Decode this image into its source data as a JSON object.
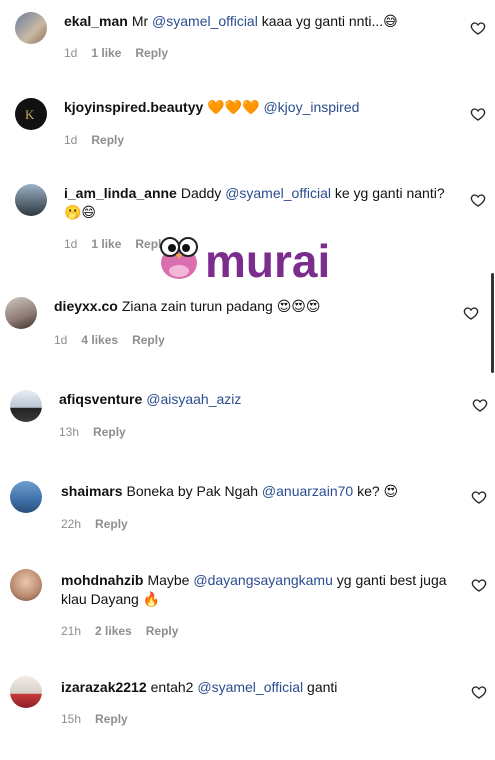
{
  "comments": [
    {
      "username": "ekal_man",
      "text_parts": [
        "Mr ",
        "@syamel_official",
        " kaaa yg ganti nnti...😅"
      ],
      "time": "1d",
      "likes": "1 like",
      "reply": "Reply"
    },
    {
      "username": "kjoyinspired.beautyy",
      "text_parts": [
        "🧡🧡🧡 ",
        "@kjoy_inspired",
        ""
      ],
      "time": "1d",
      "likes": "",
      "reply": "Reply"
    },
    {
      "username": "i_am_linda_anne",
      "text_parts": [
        "Daddy ",
        "@syamel_official",
        " ke yg ganti nanti? 🫢😄"
      ],
      "time": "1d",
      "likes": "1 like",
      "reply": "Reply"
    },
    {
      "username": "dieyxx.co",
      "text_parts": [
        "Ziana zain turun padang 😍😍😍",
        "",
        ""
      ],
      "time": "1d",
      "likes": "4 likes",
      "reply": "Reply"
    },
    {
      "username": "afiqsventure",
      "text_parts": [
        "",
        "@aisyaah_aziz",
        ""
      ],
      "time": "13h",
      "likes": "",
      "reply": "Reply"
    },
    {
      "username": "shaimars",
      "text_parts": [
        "Boneka by Pak Ngah ",
        "@anuarzain70",
        " ke? 😍"
      ],
      "time": "22h",
      "likes": "",
      "reply": "Reply"
    },
    {
      "username": "mohdnahzib",
      "text_parts": [
        "Maybe ",
        "@dayangsayangkamu",
        " yg ganti best juga klau Dayang 🔥"
      ],
      "time": "21h",
      "likes": "2 likes",
      "reply": "Reply"
    },
    {
      "username": "izarazak2212",
      "text_parts": [
        "entah2 ",
        "@syamel_official",
        " ganti"
      ],
      "time": "15h",
      "likes": "",
      "reply": "Reply"
    }
  ],
  "watermark": {
    "text": "murai"
  },
  "colors": {
    "mention": "#2a4d8f",
    "meta": "#8e8e8e",
    "watermark": "#7b2d8e"
  }
}
